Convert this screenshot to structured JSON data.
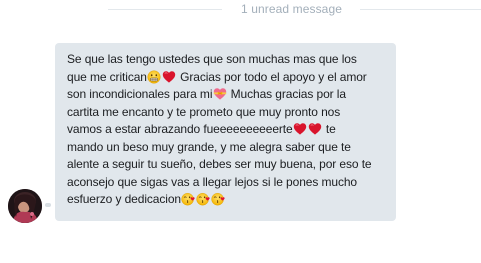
{
  "divider": {
    "label": "1 unread message"
  },
  "message": {
    "lines": [
      [
        {
          "t": "Se que las tengo ustedes que son muchas mas que los"
        }
      ],
      [
        {
          "t": "que me critican"
        },
        {
          "e": "grimacing-face-emoji"
        },
        {
          "e": "red-heart-emoji"
        },
        {
          "t": " Gracias por todo el apoyo y el amor"
        }
      ],
      [
        {
          "t": "son incondicionales para mi"
        },
        {
          "e": "heart-with-ribbon-emoji"
        },
        {
          "t": " Muchas gracias por la"
        }
      ],
      [
        {
          "t": "cartita me encanto y te prometo que muy pronto nos"
        }
      ],
      [
        {
          "t": "vamos a estar abrazando fueeeeeeeeeerte"
        },
        {
          "e": "red-heart-emoji"
        },
        {
          "e": "red-heart-emoji"
        },
        {
          "t": " te"
        }
      ],
      [
        {
          "t": "mando un beso muy grande, y me alegra saber que te"
        }
      ],
      [
        {
          "t": "alente a seguir tu sueño, debes ser muy buena, por eso te"
        }
      ],
      [
        {
          "t": "aconsejo que sigas vas a llegar lejos si le pones mucho"
        }
      ],
      [
        {
          "t": "esfuerzo y dedicacion"
        },
        {
          "e": "kissing-face-emoji"
        },
        {
          "e": "kissing-face-emoji"
        },
        {
          "e": "kissing-face-emoji"
        }
      ]
    ]
  },
  "colors": {
    "bubble": "#e1e7ec",
    "divider_text": "#a3afba",
    "divider_line": "#e3e8ec",
    "text": "#1c1e21"
  }
}
